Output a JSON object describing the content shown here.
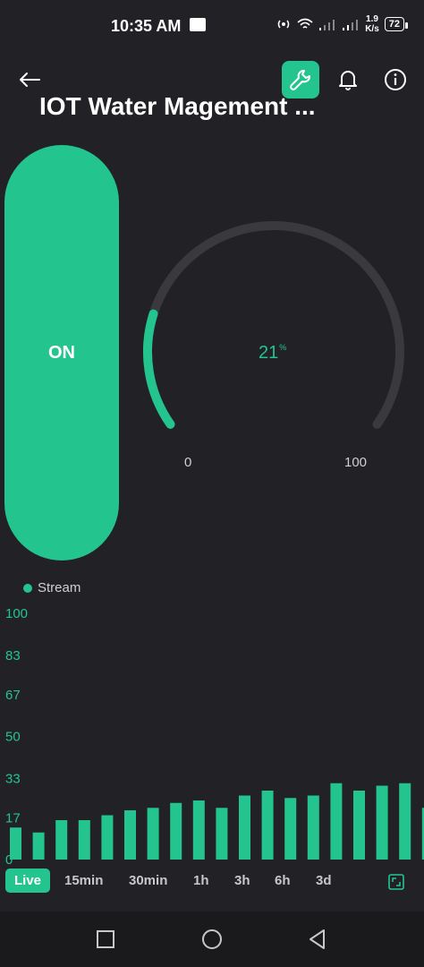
{
  "status_bar": {
    "time": "10:35 AM",
    "net_speed_value": "1.9",
    "net_speed_unit": "K/s",
    "battery": "72"
  },
  "header": {
    "title": "IOT Water Magement ...",
    "icons": [
      "back-arrow-icon",
      "wrench-icon",
      "bell-icon",
      "info-icon"
    ],
    "accent_color": "#24c48e"
  },
  "switch": {
    "label": "ON"
  },
  "gauge": {
    "value": 21,
    "value_text": "21",
    "unit": "%",
    "min": "0",
    "max": "100"
  },
  "chart_data": {
    "type": "bar",
    "legend": [
      "Stream"
    ],
    "series": [
      {
        "name": "Stream",
        "values": [
          13,
          11,
          16,
          16,
          18,
          20,
          21,
          23,
          24,
          21,
          26,
          28,
          25,
          26,
          31,
          28,
          30,
          31,
          21
        ]
      }
    ],
    "yticks": [
      "100",
      "83",
      "67",
      "50",
      "33",
      "17",
      "0"
    ],
    "ylim": [
      0,
      100
    ],
    "color": "#24c48e"
  },
  "time_ranges": [
    "Live",
    "15min",
    "30min",
    "1h",
    "3h",
    "6h",
    "3d"
  ],
  "active_range": "Live",
  "nav_icons": [
    "square-icon",
    "circle-icon",
    "triangle-back-icon"
  ]
}
